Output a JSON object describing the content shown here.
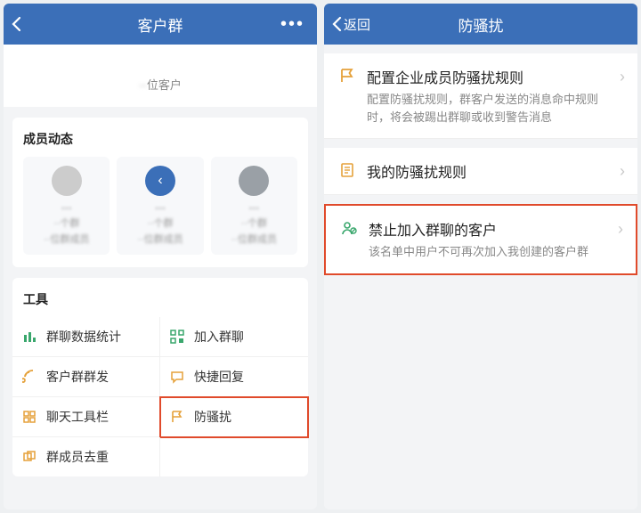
{
  "left": {
    "header": {
      "title": "客户群",
      "more": "•••"
    },
    "group": {
      "count_suffix": "位客户"
    },
    "members": {
      "title": "成员动态",
      "items": [
        {
          "name": "···",
          "line1": "··个群",
          "line2": "··位群成员"
        },
        {
          "name": "···",
          "line1": "··个群",
          "line2": "··位群成员"
        },
        {
          "name": "···",
          "line1": "··个群",
          "line2": "··位群成员"
        }
      ]
    },
    "tools": {
      "title": "工具",
      "items": [
        {
          "id": "stats",
          "label": "群聊数据统计"
        },
        {
          "id": "join",
          "label": "加入群聊"
        },
        {
          "id": "broadcast",
          "label": "客户群群发"
        },
        {
          "id": "quick",
          "label": "快捷回复"
        },
        {
          "id": "toolbar",
          "label": "聊天工具栏"
        },
        {
          "id": "anti",
          "label": "防骚扰"
        },
        {
          "id": "dedupe",
          "label": "群成员去重"
        }
      ]
    }
  },
  "right": {
    "header": {
      "back": "返回",
      "title": "防骚扰"
    },
    "settings": [
      {
        "id": "cfg-rules",
        "title": "配置企业成员防骚扰规则",
        "desc": "配置防骚扰规则，群客户发送的消息命中规则时，将会被踢出群聊或收到警告消息",
        "icon": "flag"
      },
      {
        "id": "my-rules",
        "title": "我的防骚扰规则",
        "desc": "",
        "icon": "list"
      },
      {
        "id": "blocked",
        "title": "禁止加入群聊的客户",
        "desc": "该名单中用户不可再次加入我创建的客户群",
        "icon": "user-block"
      }
    ]
  }
}
